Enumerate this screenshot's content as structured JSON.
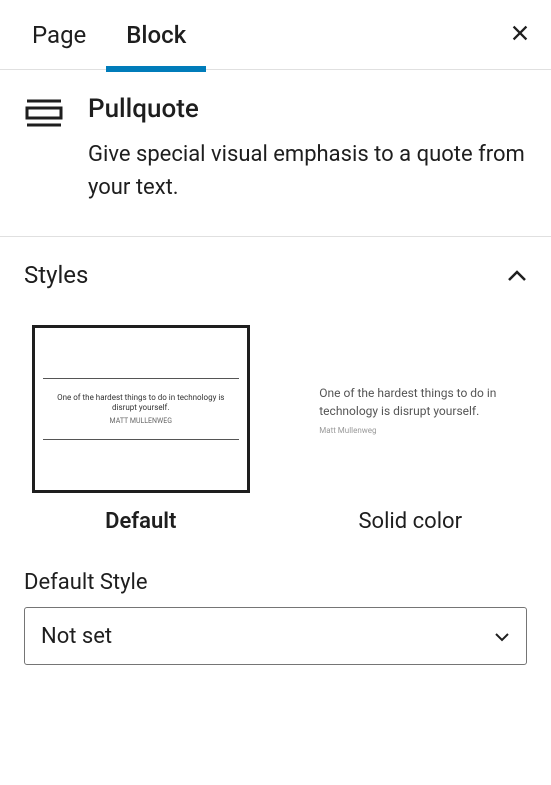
{
  "tabs": {
    "page": "Page",
    "block": "Block"
  },
  "block": {
    "title": "Pullquote",
    "description": "Give special visual emphasis to a quote from your text."
  },
  "styles": {
    "title": "Styles",
    "preview_quote": "One of the hardest things to do in technology is disrupt yourself.",
    "preview_author": "MATT MULLENWEG",
    "preview_solid_quote": "One of the hardest things to do in technology is disrupt yourself.",
    "preview_solid_author": "Matt Mullenweg",
    "options": {
      "default": "Default",
      "solid_color": "Solid color"
    },
    "default_style_label": "Default Style",
    "default_style_value": "Not set"
  }
}
